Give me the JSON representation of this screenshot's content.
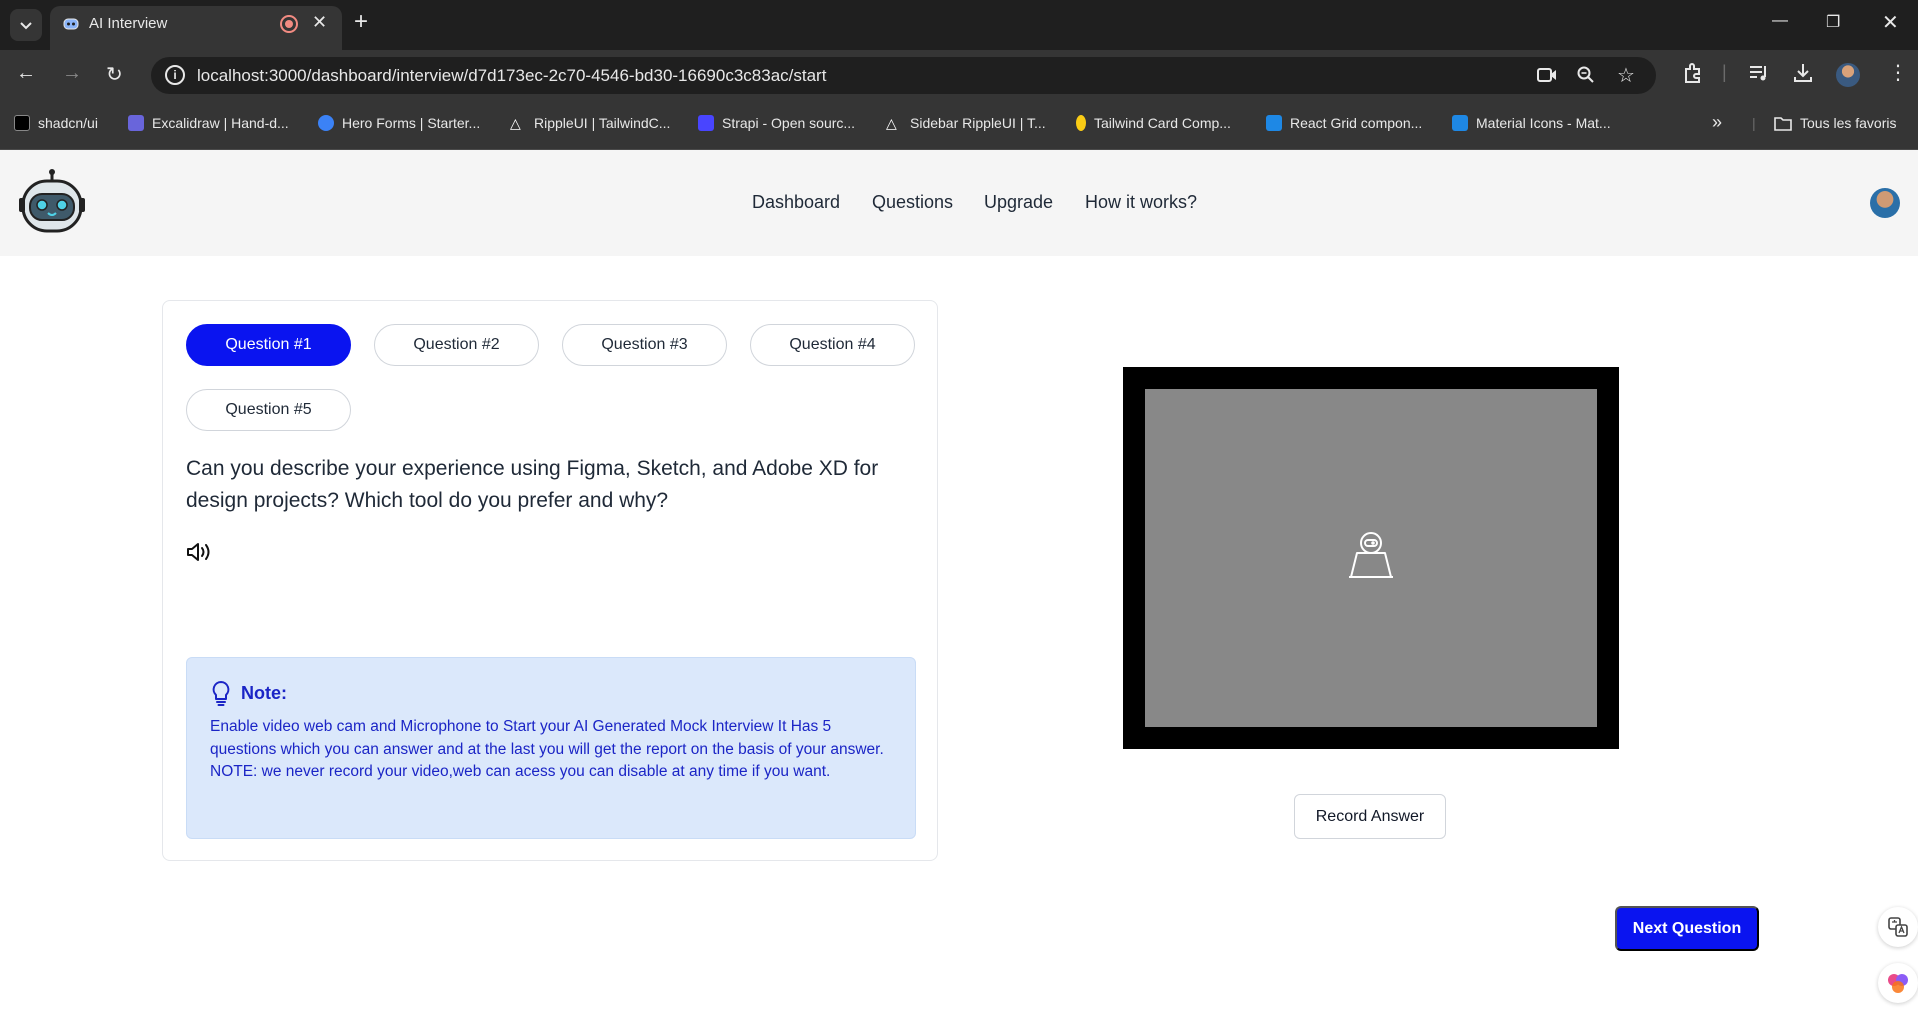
{
  "browser": {
    "tab_title": "AI Interview",
    "url": "localhost:3000/dashboard/interview/d7d173ec-2c70-4546-bd30-16690c3c83ac/start",
    "bookmarks": [
      {
        "label": "shadcn/ui",
        "color": "#000000"
      },
      {
        "label": "Excalidraw | Hand-d...",
        "color": "#6965db"
      },
      {
        "label": "Hero Forms | Starter...",
        "color": "#3b82f6"
      },
      {
        "label": "RippleUI | TailwindC...",
        "color": "#ffffff"
      },
      {
        "label": "Strapi - Open sourc...",
        "color": "#4945ff"
      },
      {
        "label": "Sidebar RippleUI | T...",
        "color": "#ffffff"
      },
      {
        "label": "Tailwind Card Comp...",
        "color": "#facc15"
      },
      {
        "label": "React Grid compon...",
        "color": "#1e88e5"
      },
      {
        "label": "Material Icons - Mat...",
        "color": "#1e88e5"
      }
    ],
    "all_bookmarks_label": "Tous les favoris"
  },
  "nav": {
    "links": [
      "Dashboard",
      "Questions",
      "Upgrade",
      "How it works?"
    ]
  },
  "questions": {
    "tabs": [
      "Question #1",
      "Question #2",
      "Question #3",
      "Question #4",
      "Question #5"
    ],
    "active_index": 0,
    "current_text": "Can you describe your experience using Figma, Sketch, and Adobe XD for design projects? Which tool do you prefer and why?"
  },
  "note": {
    "title": "Note:",
    "body": "Enable video web cam and Microphone to Start your AI Generated Mock Interview It Has 5 questions which you can answer and at the last you will get the report on the basis of your answer. NOTE: we never record your video,web can acess you can disable at any time if you want."
  },
  "actions": {
    "record_label": "Record Answer",
    "next_label": "Next Question"
  },
  "colors": {
    "primary": "#0a14f0",
    "note_bg": "#dbe8fb",
    "note_text": "#1b25c6",
    "webcam_placeholder": "#888888"
  }
}
